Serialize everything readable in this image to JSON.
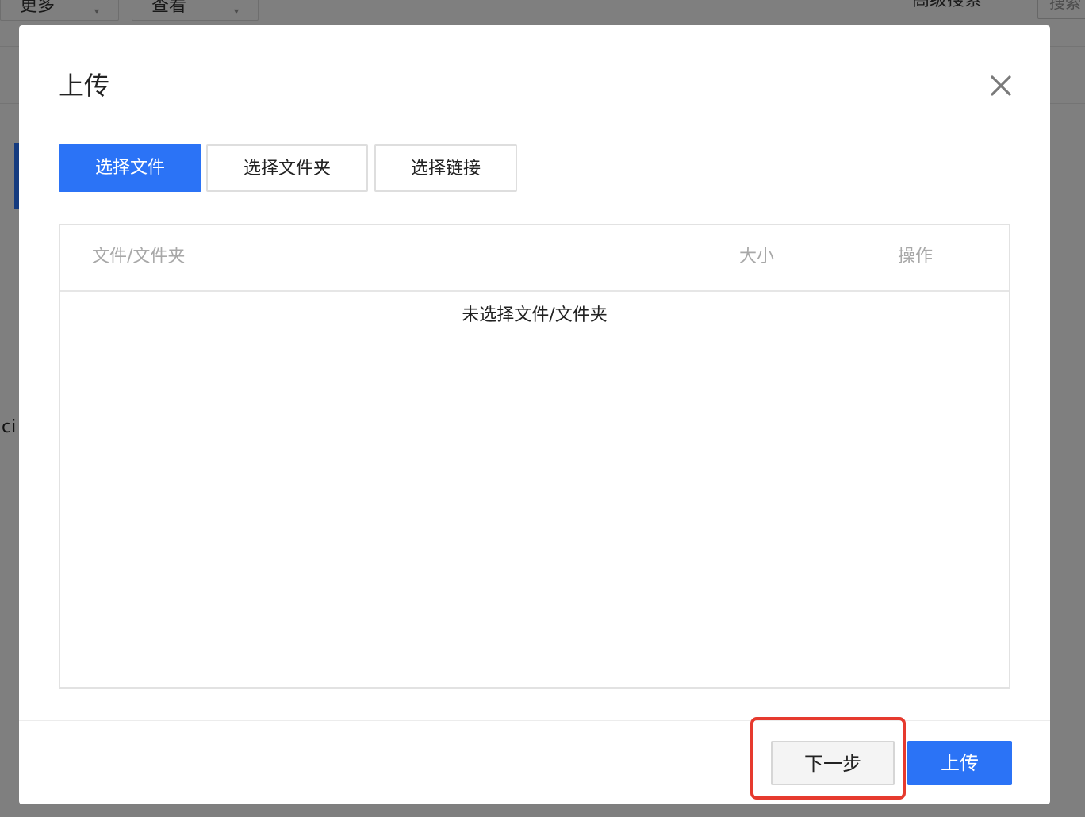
{
  "background": {
    "toolbar": {
      "more_label": "更多",
      "view_label": "查看",
      "advanced_search_label": "高级搜索",
      "search_label": "搜索"
    },
    "partial_text": "ci"
  },
  "modal": {
    "title": "上传",
    "close_icon": "close-icon",
    "tabs": [
      {
        "label": "选择文件",
        "active": true
      },
      {
        "label": "选择文件夹",
        "active": false
      },
      {
        "label": "选择链接",
        "active": false
      }
    ],
    "table": {
      "columns": [
        "文件/文件夹",
        "大小",
        "操作"
      ],
      "empty_message": "未选择文件/文件夹"
    },
    "footer": {
      "next_label": "下一步",
      "upload_label": "上传"
    }
  },
  "colors": {
    "primary": "#2b73f6",
    "highlight": "#e63a2e",
    "overlay": "rgba(0,0,0,0.5)"
  }
}
